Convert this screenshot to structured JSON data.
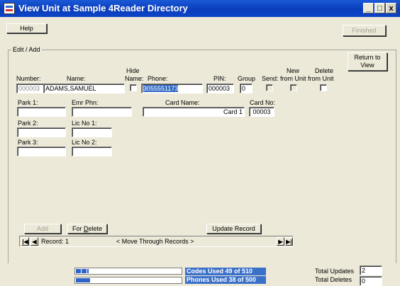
{
  "window": {
    "title": "View Unit at Sample 4Reader Directory",
    "min": "_",
    "max": "□",
    "close": "x"
  },
  "toolbar": {
    "help": "Help",
    "finished": "Finished"
  },
  "group": {
    "label": "Edit / Add"
  },
  "return_btn": {
    "line1": "Return to",
    "line2": "View"
  },
  "labels": {
    "number": "Number:",
    "name": "Name:",
    "hide1": "Hide",
    "hide2": "Name:",
    "phone": "Phone:",
    "pin": "PIN:",
    "group": "Group",
    "send": "Send:",
    "new1": "New",
    "new2": "from Unit",
    "del1": "Delete",
    "del2": "from Unit",
    "park1": "Park 1:",
    "emr": "Emr Phn:",
    "cardname": "Card Name:",
    "cardno": "Card No:",
    "park2": "Park 2:",
    "lic1": "Lic No 1:",
    "park3": "Park 3:",
    "lic2": "Lic No 2:"
  },
  "record": {
    "number": "000003",
    "name": "ADAMS,SAMUEL",
    "phone": "3055551173",
    "pin": "000003",
    "group": "0",
    "card_name": "Card 1",
    "card_no": "00003",
    "park1": "",
    "emr_phone": "",
    "park2": "",
    "lic1": "",
    "park3": "",
    "lic2": ""
  },
  "buttons": {
    "add": "Add",
    "for_delete_pre": "For ",
    "for_delete_u": "D",
    "for_delete_post": "elete",
    "update": "Update Record"
  },
  "nav": {
    "first": "|◀",
    "prev": "◀",
    "record_label": "Record: 1",
    "hint": "<  Move Through Records  >",
    "next": "▶",
    "last": "▶|"
  },
  "status": {
    "codes": "Codes  Used 49 of 510",
    "phones": "Phones Used 38 of 500",
    "total_updates_label": "Total Updates",
    "total_updates": "2",
    "total_deletes_label": "Total Deletes",
    "total_deletes": "0"
  }
}
